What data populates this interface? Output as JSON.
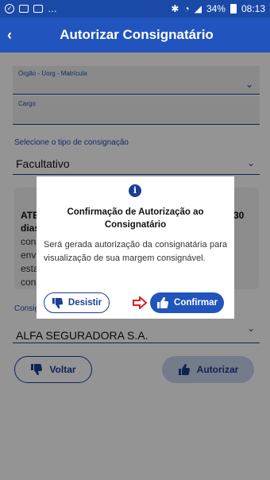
{
  "statusbar": {
    "battery": "34%",
    "time": "08:13"
  },
  "appbar": {
    "back_icon": "chevron-left-icon",
    "title": "Autorizar Consignatário"
  },
  "form": {
    "orgao_label": "Órgão - Uorg - Matrícula",
    "cargo_label": "Cargo",
    "tipo_label": "Selecione o tipo de consignação",
    "tipo_value": "Facultativo",
    "consignatario_label": "Consig",
    "consignatario_value": "ALFA SEGURADORA S.A."
  },
  "info_box": {
    "line1": "ATE",
    "line1_right": "30",
    "line2": "dias",
    "line3": "cons",
    "line4": "envi",
    "line5": "esta",
    "line6": "cons"
  },
  "buttons": {
    "voltar": "Voltar",
    "autorizar": "Autorizar"
  },
  "modal": {
    "title": "Confirmação de Autorização ao Consignatário",
    "body": "Será gerada autorização da consignatária para visualização de sua margem consignável.",
    "desistir": "Desistir",
    "confirmar": "Confirmar"
  },
  "colors": {
    "primary": "#2254bd",
    "dark_blue": "#1a3f93",
    "arrow_red": "#e02020"
  }
}
